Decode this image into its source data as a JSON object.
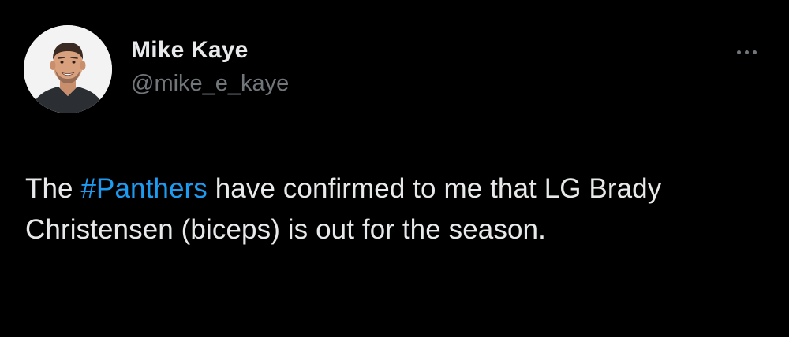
{
  "author": {
    "display_name": "Mike Kaye",
    "handle": "@mike_e_kaye"
  },
  "more_menu": {
    "icon": "more-horizontal-icon"
  },
  "tweet": {
    "text_before": "The ",
    "hashtag": "#Panthers",
    "text_after": " have confirmed to me that LG Brady Christensen (biceps) is out for the season."
  },
  "colors": {
    "background": "#000000",
    "primary_text": "#e7e9ea",
    "secondary_text": "#71767b",
    "link": "#1d9bf0"
  }
}
